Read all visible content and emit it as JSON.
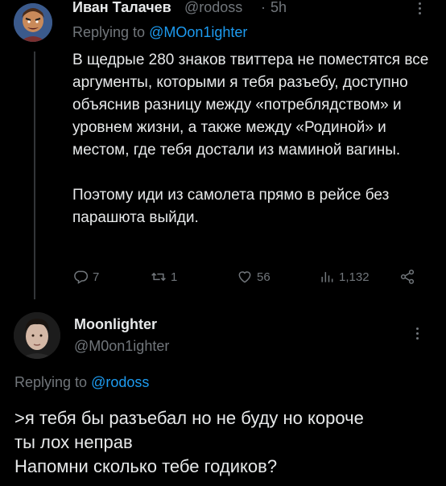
{
  "tweet": {
    "author_name": "Иван Талачев",
    "author_handle": "@rodoss",
    "separator": "·",
    "time": "5h",
    "replying_prefix": "Replying to",
    "replying_to": "@MOon1ighter",
    "body_paragraphs": [
      "В щедрые 280 знаков твиттера не поместятся все аргументы, которыми я тебя разъебу, доступно объяснив разницу между «потреблядством» и уровнем жизни, а также между «Родиной» и местом, где тебя достали из маминой вагины.",
      "Поэтому иди из самолета прямо в рейсе без парашюта выйди."
    ],
    "actions": {
      "replies": "7",
      "retweets": "1",
      "likes": "56",
      "views": "1,132"
    }
  },
  "reply": {
    "author_name": "Moonlighter",
    "author_handle": "@M0on1ighter",
    "replying_prefix": "Replying to",
    "replying_to": "@rodoss",
    "body_lines": [
      ">я тебя бы разъебал но не буду но короче",
      "ты лох неправ",
      "Напомни сколько тебе годиков?"
    ]
  },
  "colors": {
    "background": "#000000",
    "text": "#e7e9ea",
    "secondary": "#71767b",
    "link": "#1d9bf0"
  },
  "icons": [
    "reply-icon",
    "retweet-icon",
    "like-icon",
    "views-icon",
    "share-icon",
    "more-icon"
  ]
}
